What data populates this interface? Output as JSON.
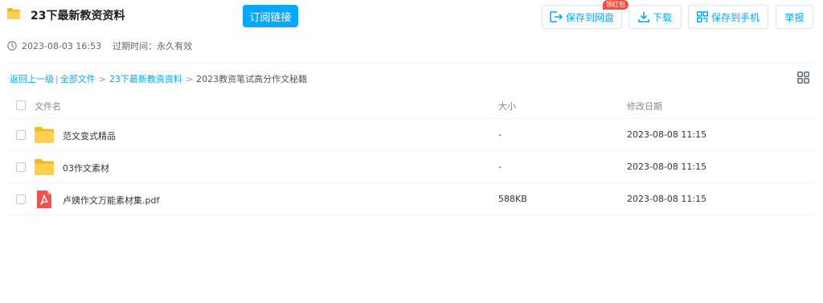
{
  "share": {
    "title": "23下最新教资资料",
    "subscribe_label": "订阅链接"
  },
  "actions": {
    "save_to_pan": "保存到网盘",
    "red_badge": "领红包",
    "download": "下载",
    "save_to_phone": "保存到手机",
    "report": "举报"
  },
  "meta": {
    "created": "2023-08-03 16:53",
    "expire_label": "过期时间：",
    "expire_value": "永久有效"
  },
  "breadcrumb": {
    "back": "返回上一级",
    "divider": "|",
    "all_files": "全部文件",
    "sep": ">",
    "level1": "23下最新教资资料",
    "current": "2023教资笔试高分作文秘籍"
  },
  "table": {
    "headers": {
      "name": "文件名",
      "size": "大小",
      "modified": "修改日期"
    },
    "rows": [
      {
        "name": "范文变式精品",
        "size": "-",
        "modified": "2023-08-08 11:15",
        "icon": "folder-icon"
      },
      {
        "name": "03作文素材",
        "size": "-",
        "modified": "2023-08-08 11:15",
        "icon": "folder-icon"
      },
      {
        "name": "卢姨作文万能素材集.pdf",
        "size": "588KB",
        "modified": "2023-08-08 11:15",
        "icon": "pdf-icon"
      }
    ]
  },
  "colors": {
    "accent": "#06a7ff",
    "badge": "#f0513f",
    "folder": "#ffc844",
    "pdf": "#ef5350"
  }
}
